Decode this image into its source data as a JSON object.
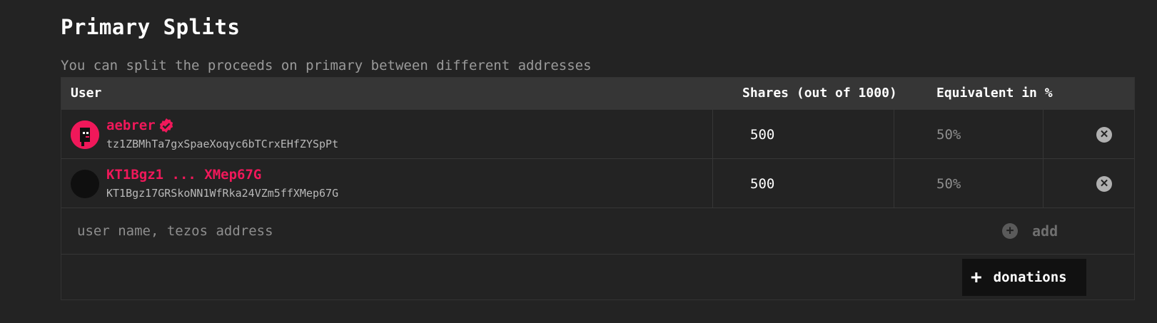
{
  "header": {
    "title": "Primary Splits",
    "subtitle": "You can split the proceeds on primary between different addresses"
  },
  "table": {
    "columns": [
      "User",
      "Shares (out of 1000)",
      "Equivalent in %"
    ],
    "rows": [
      {
        "name": "aebrer",
        "verified": true,
        "address": "tz1ZBMhTa7gxSpaeXoqyc6bTCrxEHfZYSpPt",
        "shares": "500",
        "percent": "50%",
        "remove_icon": "close-icon"
      },
      {
        "name": "KT1Bgz1 ... XMep67G",
        "verified": false,
        "address": "KT1Bgz17GRSkoNN1WfRka24VZm5ffXMep67G",
        "shares": "500",
        "percent": "50%",
        "remove_icon": "close-icon"
      }
    ]
  },
  "add_row": {
    "placeholder": "user name, tezos address",
    "add_label": "add"
  },
  "footer": {
    "donations_label": "donations",
    "donations_icon": "plus-icon"
  },
  "colors": {
    "accent": "#f0185a",
    "background": "#232323",
    "header_bg": "#363636"
  }
}
